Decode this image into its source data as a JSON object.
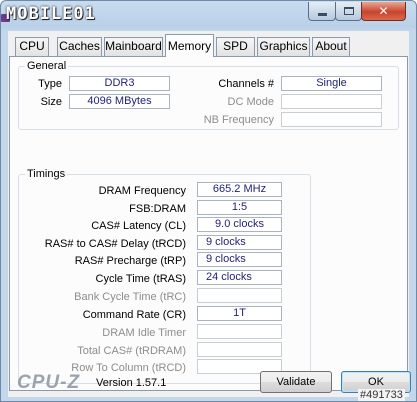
{
  "window": {
    "logo_text": "MOBILE01",
    "close_glyph": "✕"
  },
  "tabs": [
    {
      "label": "CPU"
    },
    {
      "label": "Caches"
    },
    {
      "label": "Mainboard"
    },
    {
      "label": "Memory",
      "active": true
    },
    {
      "label": "SPD"
    },
    {
      "label": "Graphics"
    },
    {
      "label": "About"
    }
  ],
  "general": {
    "title": "General",
    "type_label": "Type",
    "type_value": "DDR3",
    "size_label": "Size",
    "size_value": "4096 MBytes",
    "channels_label": "Channels #",
    "channels_value": "Single",
    "dc_mode_label": "DC Mode",
    "dc_mode_value": "",
    "nb_freq_label": "NB Frequency",
    "nb_freq_value": ""
  },
  "timings": {
    "title": "Timings",
    "rows": [
      {
        "label": "DRAM Frequency",
        "value": "665.2 MHz",
        "enabled": true
      },
      {
        "label": "FSB:DRAM",
        "value": "1:5",
        "enabled": true
      },
      {
        "label": "CAS# Latency (CL)",
        "value": "9.0 clocks",
        "enabled": true
      },
      {
        "label": "RAS# to CAS# Delay (tRCD)",
        "value": "9 clocks",
        "enabled": true
      },
      {
        "label": "RAS# Precharge (tRP)",
        "value": "9 clocks",
        "enabled": true
      },
      {
        "label": "Cycle Time (tRAS)",
        "value": "24 clocks",
        "enabled": true
      },
      {
        "label": "Bank Cycle Time (tRC)",
        "value": "",
        "enabled": false
      },
      {
        "label": "Command Rate (CR)",
        "value": "1T",
        "enabled": true
      },
      {
        "label": "DRAM Idle Timer",
        "value": "",
        "enabled": false
      },
      {
        "label": "Total CAS# (tRDRAM)",
        "value": "",
        "enabled": false
      },
      {
        "label": "Row To Column (tRCD)",
        "value": "",
        "enabled": false
      }
    ]
  },
  "footer": {
    "brand": "CPU-Z",
    "version": "Version 1.57.1",
    "validate_label": "Validate",
    "ok_label": "OK"
  },
  "watermark": "#491733"
}
